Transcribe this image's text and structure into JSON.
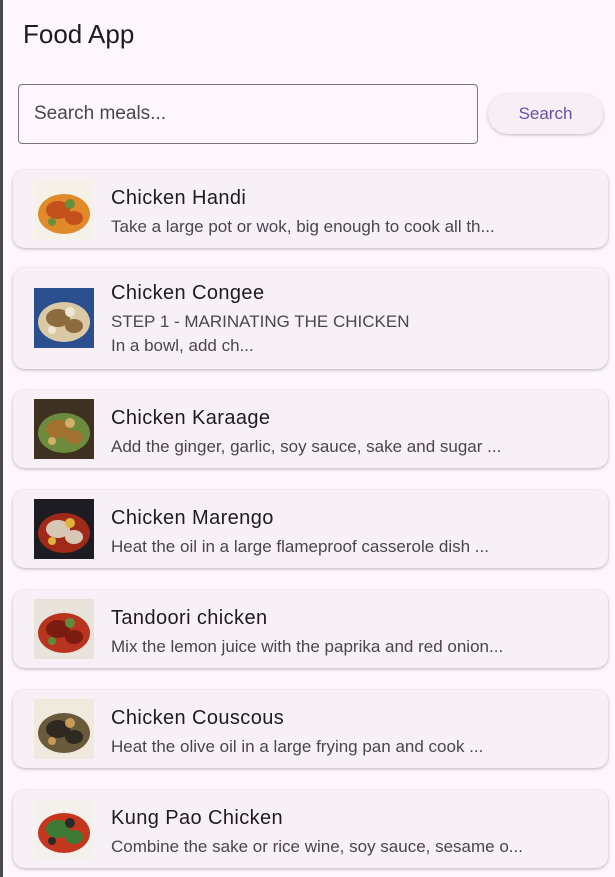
{
  "app_bar": {
    "title": "Food App"
  },
  "search": {
    "placeholder": "Search meals...",
    "value": "",
    "button_label": "Search"
  },
  "meals": [
    {
      "name": "Chicken Handi",
      "description": "Take a large pot or wok, big enough to cook all th...",
      "thumb_colors": [
        "#f5f0e8",
        "#e08a2a",
        "#c4501d",
        "#6b8e3a"
      ]
    },
    {
      "name": "Chicken Congee",
      "description": "STEP 1 - MARINATING THE CHICKEN\nIn a bowl, add ch...",
      "thumb_colors": [
        "#2b4f8e",
        "#d9c9a5",
        "#8c6b3f",
        "#f0e6d2"
      ]
    },
    {
      "name": "Chicken Karaage",
      "description": "Add the ginger, garlic, soy sauce, sake and sugar ...",
      "thumb_colors": [
        "#3e3122",
        "#6d8b3c",
        "#a2712f",
        "#d2b06a"
      ]
    },
    {
      "name": "Chicken Marengo",
      "description": "Heat the oil in a large flameproof casserole dish ...",
      "thumb_colors": [
        "#1c1c22",
        "#a02a1a",
        "#d8c7b6",
        "#e0b33c"
      ]
    },
    {
      "name": "Tandoori chicken",
      "description": "Mix the lemon juice with the paprika and red onion...",
      "thumb_colors": [
        "#e9e4db",
        "#b8341f",
        "#7a1c12",
        "#5e8c3a"
      ]
    },
    {
      "name": "Chicken Couscous",
      "description": "Heat the olive oil in a large frying pan and cook ...",
      "thumb_colors": [
        "#efe9de",
        "#6a5a3c",
        "#2e2a22",
        "#c79a55"
      ]
    },
    {
      "name": "Kung Pao Chicken",
      "description": "Combine the sake or rice wine, soy sauce, sesame o...",
      "thumb_colors": [
        "#f4f1ec",
        "#c5361f",
        "#3d7a35",
        "#2a2a2a"
      ]
    }
  ]
}
